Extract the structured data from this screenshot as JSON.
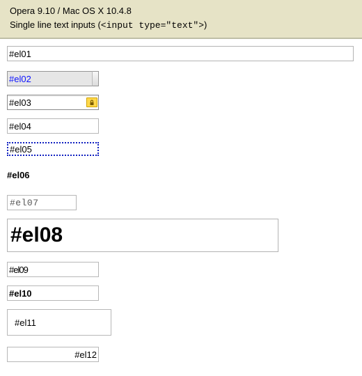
{
  "header": {
    "title": "Opera 9.10 / Mac OS X 10.4.8",
    "subtitle_prefix": "Single line text inputs (",
    "subtitle_code": "<input type=\"text\">",
    "subtitle_suffix": ")"
  },
  "inputs": {
    "el01": "#el01",
    "el02": "#el02",
    "el03": "#el03",
    "el04": "#el04",
    "el05": "#el05",
    "el06": "#el06",
    "el07": "#el07",
    "el08": "#el08",
    "el09": "#el09",
    "el10": "#el10",
    "el11": "#el11",
    "el12": "#el12"
  }
}
